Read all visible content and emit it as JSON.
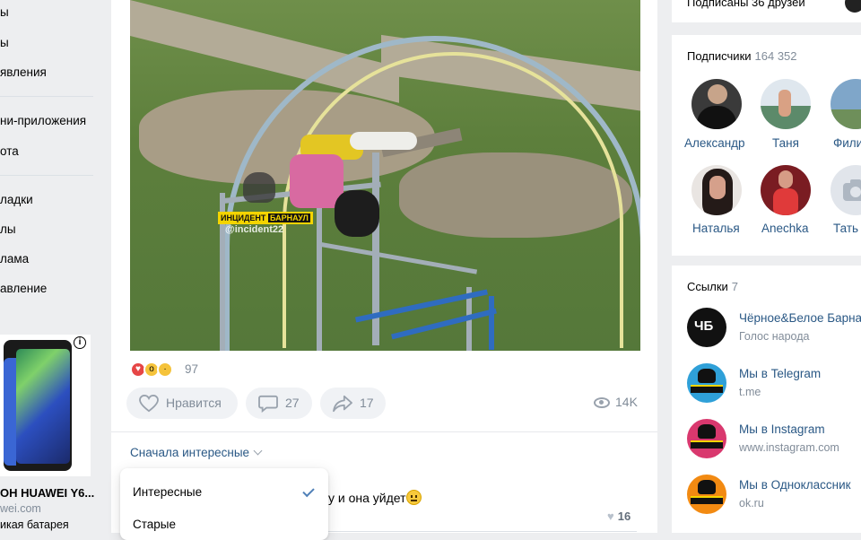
{
  "left_nav": {
    "items": [
      "ы",
      "ы",
      "явления",
      "ни-приложения",
      "ота",
      "ладки",
      "лы",
      "лама",
      "авление"
    ]
  },
  "ad": {
    "title": "OH HUAWEI Y6...",
    "domain": "wei.com",
    "desc": "икая батарея",
    "info_icon": "info-icon"
  },
  "post": {
    "photo_icon": "photo",
    "watermark": {
      "brand_left": "ИНЦИДЕНТ",
      "brand_right": "БАРНАУЛ",
      "handle": "@incident22"
    },
    "reactions": {
      "count": "97",
      "icons": [
        "heart-reaction-icon",
        "wow-reaction-icon",
        "sad-reaction-icon"
      ]
    },
    "like_label": "Нравится",
    "comments_count": "27",
    "shares_count": "17",
    "views_count": "14K",
    "sort_label": "Сначала интересные",
    "comment_fragment": "у и она уйдет",
    "comment_likes": "16",
    "sort_menu": {
      "items": [
        "Интересные",
        "Старые"
      ],
      "selected": "Интересные"
    }
  },
  "right": {
    "top_strip_text": "Подписаны 36 друзей",
    "subscribers": {
      "title": "Подписчики",
      "count": "164 352",
      "people": [
        {
          "name": "Александр",
          "color": "#3a3a3a"
        },
        {
          "name": "Таня",
          "color": "#e9eef2"
        },
        {
          "name": "Фили",
          "color": "#7fa6c9"
        },
        {
          "name": "Наталья",
          "color": "#2b1f1d"
        },
        {
          "name": "Anechka",
          "color": "#c8323a"
        },
        {
          "name": "Тать",
          "color": "#e1e5eb"
        }
      ]
    },
    "links": {
      "title": "Ссылки",
      "count": "7",
      "items": [
        {
          "name": "Чёрное&Белое Барна",
          "sub": "Голос народа",
          "color": "#111111"
        },
        {
          "name": "Мы в Telegram",
          "sub": "t.me",
          "color": "#2fa0d8"
        },
        {
          "name": "Мы в Instagram",
          "sub": "www.instagram.com",
          "color": "#d9386e"
        },
        {
          "name": "Мы в Одноклассник",
          "sub": "ok.ru",
          "color": "#f28a12"
        }
      ]
    }
  },
  "colors": {
    "link": "#2a5885",
    "muted": "#818c99",
    "bg": "#edeef0",
    "accent": "#5181b8"
  }
}
